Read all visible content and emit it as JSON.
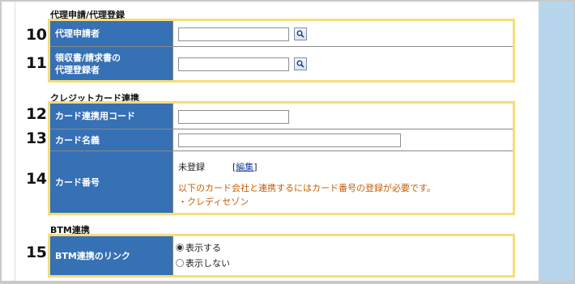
{
  "sections": {
    "proxy": {
      "title": "代理申請/代理登録",
      "rows": [
        {
          "number": "10",
          "label": "代理申請者"
        },
        {
          "number": "11",
          "label": "領収書/請求書の\n代理登録者"
        }
      ]
    },
    "credit": {
      "title": "クレジットカード連携",
      "rows": [
        {
          "number": "12",
          "label": "カード連携用コード"
        },
        {
          "number": "13",
          "label": "カード名義"
        },
        {
          "number": "14",
          "label": "カード番号"
        }
      ],
      "card_number": {
        "status": "未登録",
        "edit_open": "[",
        "edit_link": "編集",
        "edit_close": "]",
        "notice": "以下のカード会社と連携するにはカード番号の登録が必要です。",
        "company": "・クレディセゾン"
      }
    },
    "btm": {
      "title": "BTM連携",
      "rows": [
        {
          "number": "15",
          "label": "BTM連携のリンク"
        }
      ],
      "options": [
        {
          "label": "表示する",
          "checked": true
        },
        {
          "label": "表示しない",
          "checked": false
        }
      ]
    }
  },
  "icons": {
    "search": "search-icon"
  },
  "colors": {
    "label_bg": "#3670b5",
    "highlight_border": "#f4dd7a",
    "notice": "#c65f06",
    "side_panel": "#b7d6ec"
  }
}
